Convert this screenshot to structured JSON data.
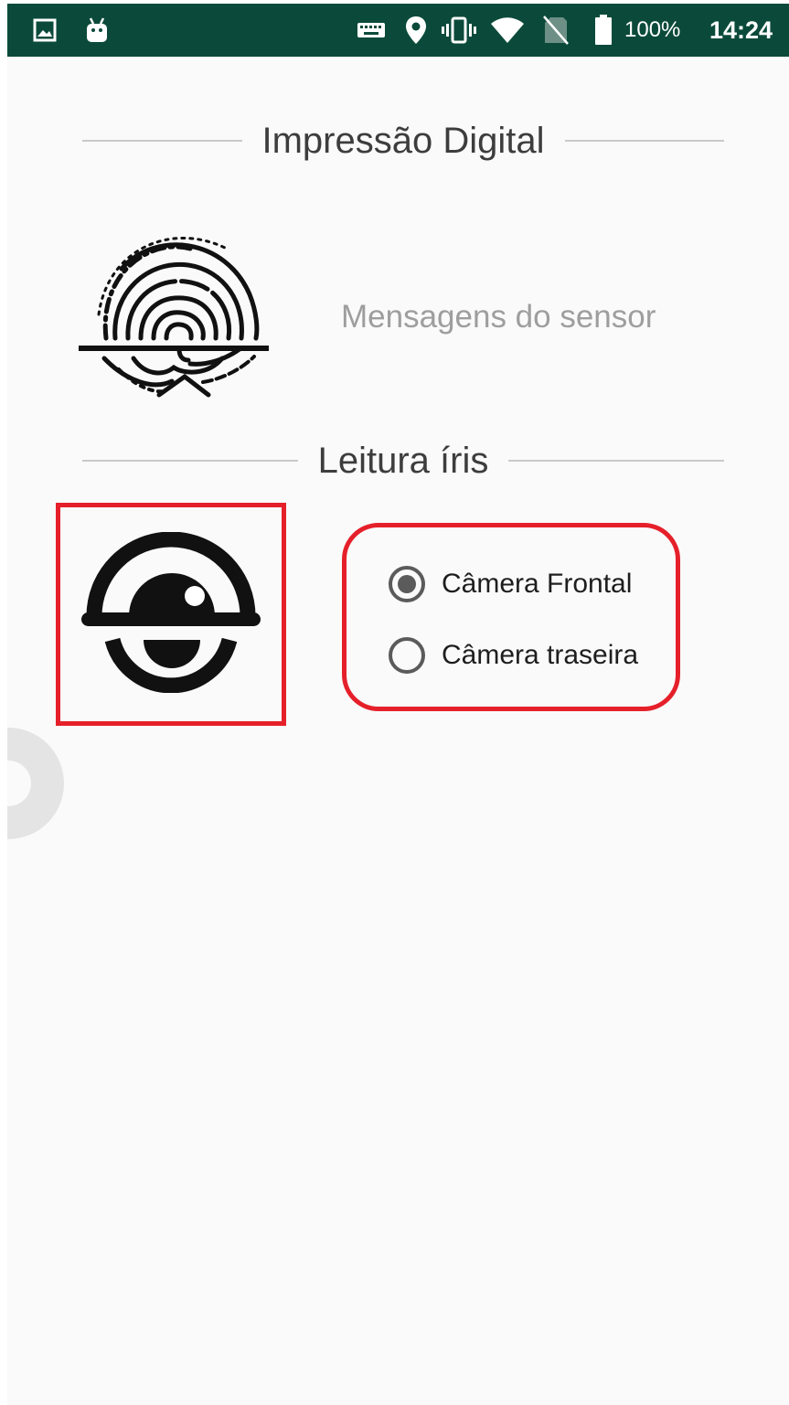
{
  "status_bar": {
    "battery": "100%",
    "time": "14:24",
    "left_icons": [
      "gallery-icon",
      "android-icon"
    ],
    "right_icons": [
      "keyboard-icon",
      "location-icon",
      "vibrate-icon",
      "wifi-icon",
      "no-sim-icon",
      "battery-icon"
    ],
    "background_color": "#0b4a3a"
  },
  "fingerprint_section": {
    "title": "Impressão Digital",
    "icon": "fingerprint-icon",
    "message": "Mensagens do sensor"
  },
  "iris_section": {
    "title": "Leitura íris",
    "icon": "iris-scan-icon",
    "camera_options": [
      {
        "label": "Câmera Frontal",
        "selected": true
      },
      {
        "label": "Câmera traseira",
        "selected": false
      }
    ]
  },
  "colors": {
    "highlight_border": "#e5202a",
    "text_primary": "#1e1e1e",
    "text_secondary": "#9e9e9e"
  }
}
